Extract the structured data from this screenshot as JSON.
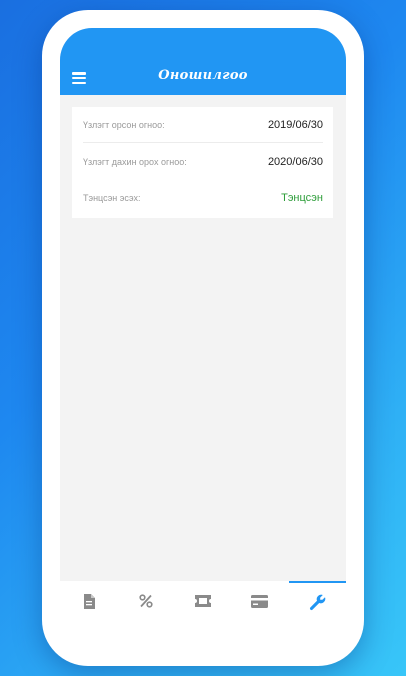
{
  "header": {
    "title": "Оношилгоо",
    "menu_icon": "menu-icon"
  },
  "card": {
    "rows": [
      {
        "label": "Үзлэгт орсон огноо:",
        "value": "2019/06/30"
      },
      {
        "label": "Үзлэгт дахин орох огноо:",
        "value": "2020/06/30"
      },
      {
        "label": "Тэнцсэн эсэх:",
        "value": "Тэнцсэн"
      }
    ]
  },
  "tabbar": {
    "tabs": [
      {
        "icon": "document-icon",
        "active": false
      },
      {
        "icon": "percent-icon",
        "active": false
      },
      {
        "icon": "ticket-icon",
        "active": false
      },
      {
        "icon": "credit-card-icon",
        "active": false
      },
      {
        "icon": "wrench-icon",
        "active": true
      }
    ]
  },
  "colors": {
    "accent": "#2196f3",
    "success": "#2e9e3a",
    "icon_inactive": "#8a8a8a"
  }
}
